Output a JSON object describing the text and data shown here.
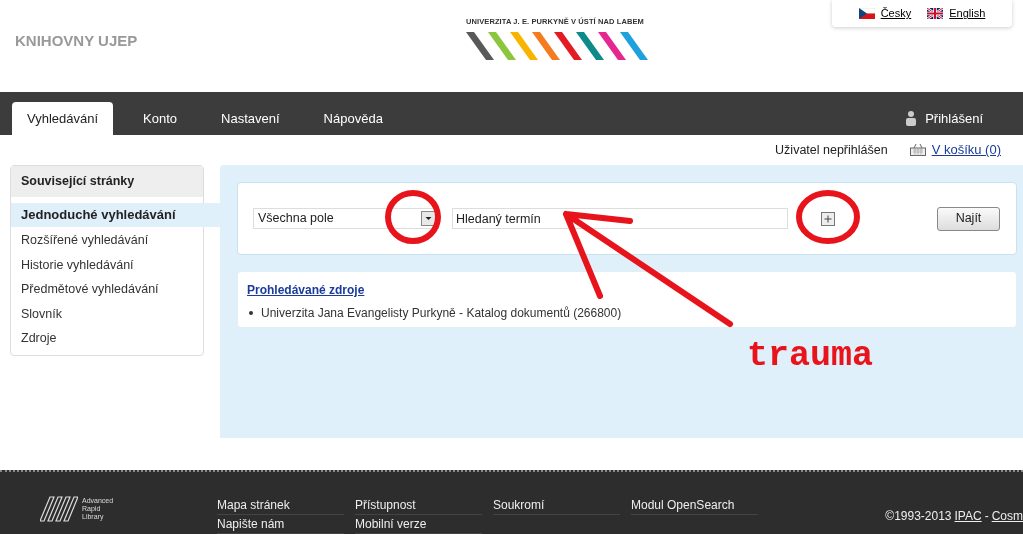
{
  "header": {
    "site_title": "KNIHOVNY UJEP",
    "logo_text": "UNIVERZITA J. E. PURKYNĚ V ÚSTÍ NAD LABEM",
    "languages": [
      {
        "label": "Česky",
        "kind": "cz"
      },
      {
        "label": "English",
        "kind": "en"
      }
    ]
  },
  "nav": {
    "tabs": [
      {
        "label": "Vyhledávání",
        "selected": true
      },
      {
        "label": "Konto",
        "selected": false
      },
      {
        "label": "Nastavení",
        "selected": false
      },
      {
        "label": "Nápověda",
        "selected": false
      }
    ],
    "login": "Přihlášení"
  },
  "user_bar": {
    "status": "Uživatel nepřihlášen",
    "basket": "V košíku (0)"
  },
  "sidebar": {
    "title": "Související stránky",
    "items": [
      {
        "label": "Jednoduché vyhledávání",
        "selected": true
      },
      {
        "label": "Rozšířené vyhledávání",
        "selected": false
      },
      {
        "label": "Historie vyhledávání",
        "selected": false
      },
      {
        "label": "Předmětové vyhledávání",
        "selected": false
      },
      {
        "label": "Slovník",
        "selected": false
      },
      {
        "label": "Zdroje",
        "selected": false
      }
    ]
  },
  "search": {
    "field_select": "Všechna pole",
    "placeholder": "Hledaný termín",
    "submit": "Najít"
  },
  "sources": {
    "title": "Prohledávané zdroje",
    "items": [
      "Univerzita Jana Evangelisty Purkyně - Katalog dokumentů (266800)"
    ]
  },
  "annotation": {
    "text": "trauma"
  },
  "footer": {
    "logo_text": [
      "Advanced",
      "Rapid",
      "Library"
    ],
    "columns": [
      [
        "Mapa stránek",
        "Napište nám"
      ],
      [
        "Přístupnost",
        "Mobilní verze"
      ],
      [
        "Soukromí"
      ],
      [
        "Modul OpenSearch"
      ]
    ],
    "copyright": "©1993-2013",
    "links": [
      "IPAC",
      "Cosm"
    ],
    "separator": "-"
  }
}
